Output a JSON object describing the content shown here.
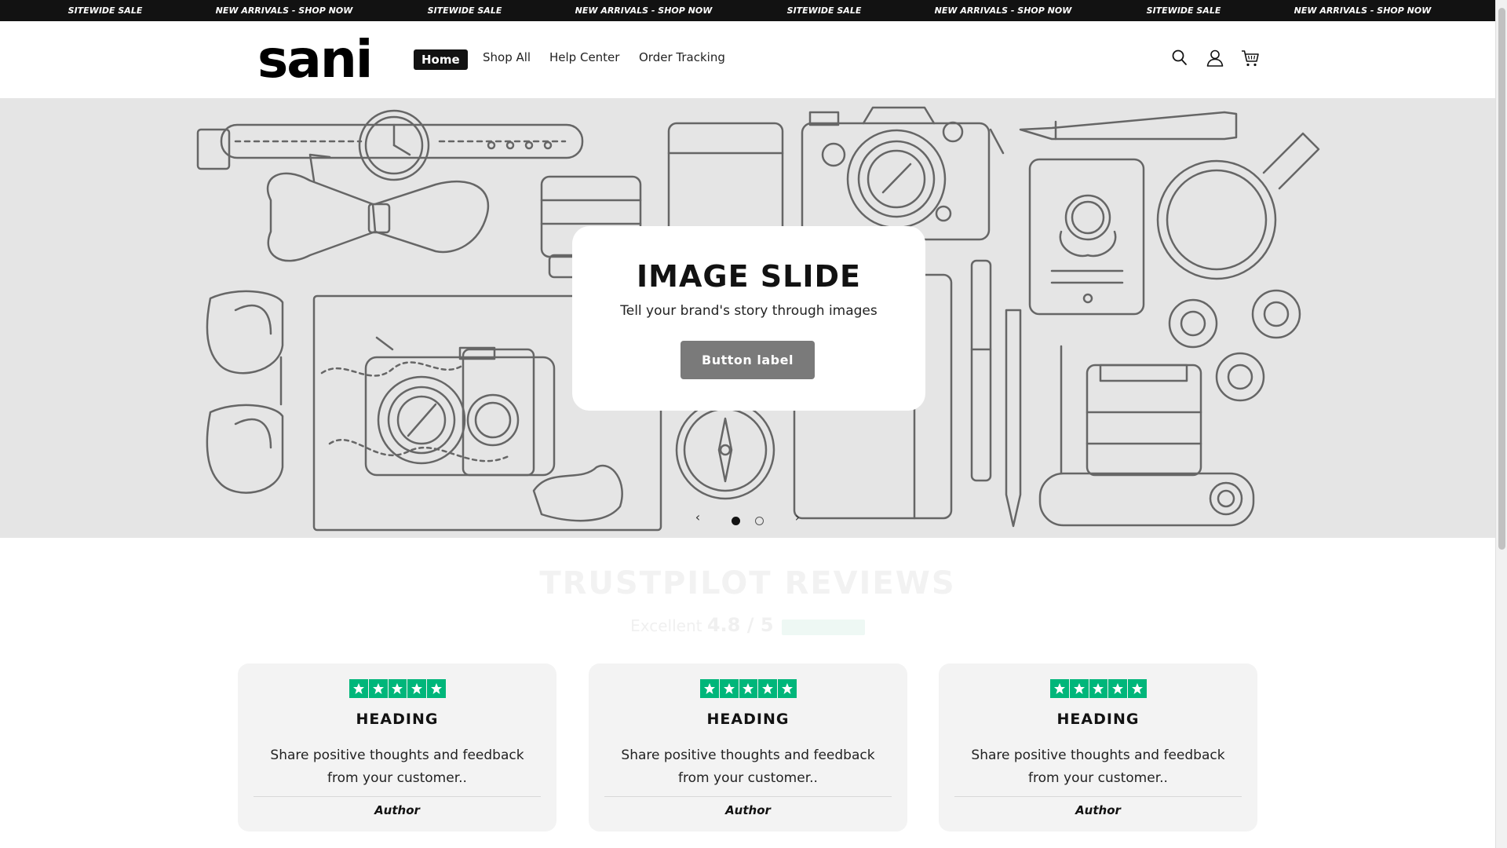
{
  "announcement": {
    "items": [
      "SITEWIDE SALE",
      "NEW ARRIVALS - SHOP NOW",
      "SITEWIDE SALE",
      "NEW ARRIVALS - SHOP NOW",
      "SITEWIDE SALE",
      "NEW ARRIVALS - SHOP NOW",
      "SITEWIDE SALE",
      "NEW ARRIVALS - SHOP NOW"
    ]
  },
  "header": {
    "logo": "sani",
    "nav": [
      "Home",
      "Shop All",
      "Help Center",
      "Order Tracking"
    ],
    "active_nav": "Home",
    "icons": [
      "search-icon",
      "account-icon",
      "cart-icon"
    ]
  },
  "hero": {
    "title": "IMAGE SLIDE",
    "subtitle": "Tell your brand's story through images",
    "button_label": "Button label",
    "slide_count": 2,
    "active_slide": 1
  },
  "reviews": {
    "title": "TRUSTPILOT REVIEWS",
    "rating_word": "Excellent",
    "rating_value": "4.8 / 5",
    "cards": [
      {
        "stars": 5,
        "heading": "HEADING",
        "text": "Share positive thoughts and feedback from your customer..",
        "author": "Author"
      },
      {
        "stars": 5,
        "heading": "HEADING",
        "text": "Share positive thoughts and feedback from your customer..",
        "author": "Author"
      },
      {
        "stars": 5,
        "heading": "HEADING",
        "text": "Share positive thoughts and feedback from your customer..",
        "author": "Author"
      }
    ]
  },
  "colors": {
    "announcement_bg": "#121212",
    "hero_bg": "#e5e5e5",
    "button_bg": "#7a7a7a",
    "trustpilot_green": "#00b67a",
    "card_bg": "#f3f3f3"
  }
}
